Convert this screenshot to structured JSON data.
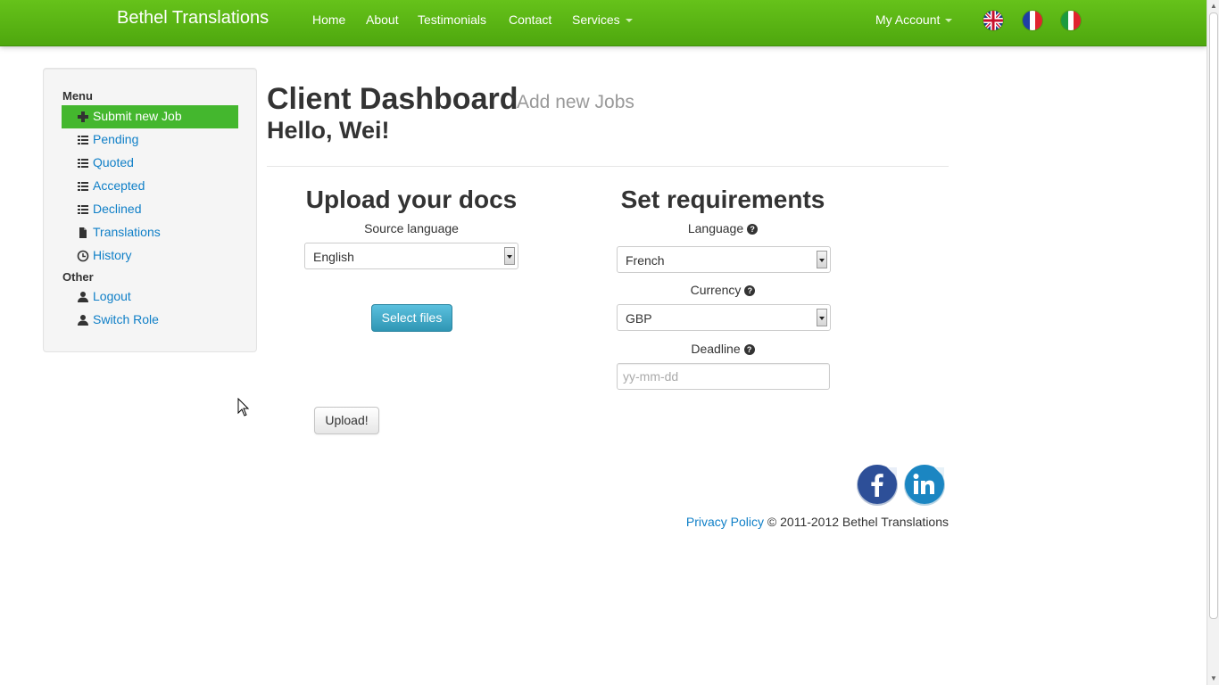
{
  "navbar": {
    "brand": "Bethel Translations",
    "links": [
      "Home",
      "About",
      "Testimonials",
      "Contact"
    ],
    "services": "Services",
    "account": "My Account",
    "flags": [
      "uk-flag-icon",
      "france-flag-icon",
      "italy-flag-icon"
    ]
  },
  "sidebar": {
    "menu_header": "Menu",
    "other_header": "Other",
    "menu_items": [
      {
        "label": "Submit new Job",
        "icon": "plus-icon"
      },
      {
        "label": "Pending",
        "icon": "list-icon"
      },
      {
        "label": "Quoted",
        "icon": "list-icon"
      },
      {
        "label": "Accepted",
        "icon": "list-icon"
      },
      {
        "label": "Declined",
        "icon": "list-icon"
      },
      {
        "label": "Translations",
        "icon": "file-icon"
      },
      {
        "label": "History",
        "icon": "clock-icon"
      }
    ],
    "other_items": [
      {
        "label": "Logout",
        "icon": "user-icon"
      },
      {
        "label": "Switch Role",
        "icon": "user-icon"
      }
    ]
  },
  "main": {
    "title": "Client Dashboard",
    "subtitle": "Add new Jobs",
    "greeting": "Hello, Wei!",
    "upload": {
      "title": "Upload your docs",
      "source_label": "Source language",
      "source_value": "English",
      "select_files": "Select files",
      "upload_button": "Upload!"
    },
    "requirements": {
      "title": "Set requirements",
      "language_label": "Language",
      "language_value": "French",
      "currency_label": "Currency",
      "currency_value": "GBP",
      "deadline_label": "Deadline",
      "deadline_placeholder": "yy-mm-dd"
    }
  },
  "footer": {
    "privacy": "Privacy Policy",
    "copyright": "© 2011-2012 Bethel Translations"
  },
  "colors": {
    "navbar": "#5cb516",
    "active_item": "#44b72e",
    "link": "#0f7fc7",
    "info_button": "#49afcd"
  }
}
